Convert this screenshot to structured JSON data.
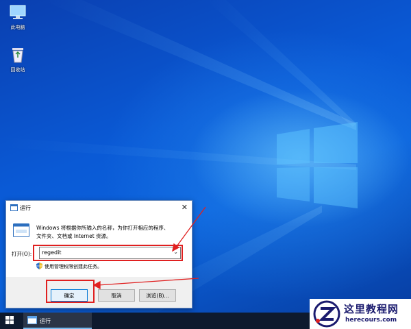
{
  "desktop": {
    "icons": [
      {
        "label": "此电脑",
        "icon": "computer-icon"
      },
      {
        "label": "回收站",
        "icon": "recycle-bin-icon"
      }
    ]
  },
  "run_dialog": {
    "title": "运行",
    "description_line1": "Windows 将根据你所输入的名称，为你打开相应的程序、",
    "description_line2": "文件夹、文档或 Internet 资源。",
    "open_label": "打开(O):",
    "open_value": "regedit",
    "admin_note": "使用管理权限创建此任务。",
    "ok_label": "确定",
    "cancel_label": "取消",
    "browse_label": "浏览(B)..."
  },
  "taskbar": {
    "running_app": "运行"
  },
  "watermark": {
    "name": "这里教程网",
    "url": "herecours.com"
  },
  "colors": {
    "accent": "#0078d7",
    "annotation": "#e02020",
    "taskbar": "#0e1a2e"
  }
}
